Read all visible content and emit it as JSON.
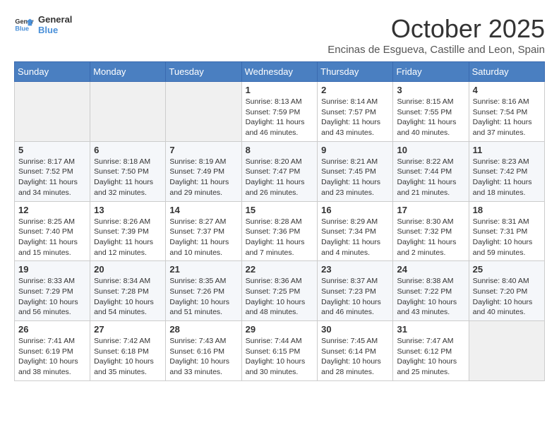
{
  "logo": {
    "general": "General",
    "blue": "Blue"
  },
  "header": {
    "month": "October 2025",
    "location": "Encinas de Esgueva, Castille and Leon, Spain"
  },
  "weekdays": [
    "Sunday",
    "Monday",
    "Tuesday",
    "Wednesday",
    "Thursday",
    "Friday",
    "Saturday"
  ],
  "weeks": [
    [
      {
        "day": "",
        "info": ""
      },
      {
        "day": "",
        "info": ""
      },
      {
        "day": "",
        "info": ""
      },
      {
        "day": "1",
        "info": "Sunrise: 8:13 AM\nSunset: 7:59 PM\nDaylight: 11 hours and 46 minutes."
      },
      {
        "day": "2",
        "info": "Sunrise: 8:14 AM\nSunset: 7:57 PM\nDaylight: 11 hours and 43 minutes."
      },
      {
        "day": "3",
        "info": "Sunrise: 8:15 AM\nSunset: 7:55 PM\nDaylight: 11 hours and 40 minutes."
      },
      {
        "day": "4",
        "info": "Sunrise: 8:16 AM\nSunset: 7:54 PM\nDaylight: 11 hours and 37 minutes."
      }
    ],
    [
      {
        "day": "5",
        "info": "Sunrise: 8:17 AM\nSunset: 7:52 PM\nDaylight: 11 hours and 34 minutes."
      },
      {
        "day": "6",
        "info": "Sunrise: 8:18 AM\nSunset: 7:50 PM\nDaylight: 11 hours and 32 minutes."
      },
      {
        "day": "7",
        "info": "Sunrise: 8:19 AM\nSunset: 7:49 PM\nDaylight: 11 hours and 29 minutes."
      },
      {
        "day": "8",
        "info": "Sunrise: 8:20 AM\nSunset: 7:47 PM\nDaylight: 11 hours and 26 minutes."
      },
      {
        "day": "9",
        "info": "Sunrise: 8:21 AM\nSunset: 7:45 PM\nDaylight: 11 hours and 23 minutes."
      },
      {
        "day": "10",
        "info": "Sunrise: 8:22 AM\nSunset: 7:44 PM\nDaylight: 11 hours and 21 minutes."
      },
      {
        "day": "11",
        "info": "Sunrise: 8:23 AM\nSunset: 7:42 PM\nDaylight: 11 hours and 18 minutes."
      }
    ],
    [
      {
        "day": "12",
        "info": "Sunrise: 8:25 AM\nSunset: 7:40 PM\nDaylight: 11 hours and 15 minutes."
      },
      {
        "day": "13",
        "info": "Sunrise: 8:26 AM\nSunset: 7:39 PM\nDaylight: 11 hours and 12 minutes."
      },
      {
        "day": "14",
        "info": "Sunrise: 8:27 AM\nSunset: 7:37 PM\nDaylight: 11 hours and 10 minutes."
      },
      {
        "day": "15",
        "info": "Sunrise: 8:28 AM\nSunset: 7:36 PM\nDaylight: 11 hours and 7 minutes."
      },
      {
        "day": "16",
        "info": "Sunrise: 8:29 AM\nSunset: 7:34 PM\nDaylight: 11 hours and 4 minutes."
      },
      {
        "day": "17",
        "info": "Sunrise: 8:30 AM\nSunset: 7:32 PM\nDaylight: 11 hours and 2 minutes."
      },
      {
        "day": "18",
        "info": "Sunrise: 8:31 AM\nSunset: 7:31 PM\nDaylight: 10 hours and 59 minutes."
      }
    ],
    [
      {
        "day": "19",
        "info": "Sunrise: 8:33 AM\nSunset: 7:29 PM\nDaylight: 10 hours and 56 minutes."
      },
      {
        "day": "20",
        "info": "Sunrise: 8:34 AM\nSunset: 7:28 PM\nDaylight: 10 hours and 54 minutes."
      },
      {
        "day": "21",
        "info": "Sunrise: 8:35 AM\nSunset: 7:26 PM\nDaylight: 10 hours and 51 minutes."
      },
      {
        "day": "22",
        "info": "Sunrise: 8:36 AM\nSunset: 7:25 PM\nDaylight: 10 hours and 48 minutes."
      },
      {
        "day": "23",
        "info": "Sunrise: 8:37 AM\nSunset: 7:23 PM\nDaylight: 10 hours and 46 minutes."
      },
      {
        "day": "24",
        "info": "Sunrise: 8:38 AM\nSunset: 7:22 PM\nDaylight: 10 hours and 43 minutes."
      },
      {
        "day": "25",
        "info": "Sunrise: 8:40 AM\nSunset: 7:20 PM\nDaylight: 10 hours and 40 minutes."
      }
    ],
    [
      {
        "day": "26",
        "info": "Sunrise: 7:41 AM\nSunset: 6:19 PM\nDaylight: 10 hours and 38 minutes."
      },
      {
        "day": "27",
        "info": "Sunrise: 7:42 AM\nSunset: 6:18 PM\nDaylight: 10 hours and 35 minutes."
      },
      {
        "day": "28",
        "info": "Sunrise: 7:43 AM\nSunset: 6:16 PM\nDaylight: 10 hours and 33 minutes."
      },
      {
        "day": "29",
        "info": "Sunrise: 7:44 AM\nSunset: 6:15 PM\nDaylight: 10 hours and 30 minutes."
      },
      {
        "day": "30",
        "info": "Sunrise: 7:45 AM\nSunset: 6:14 PM\nDaylight: 10 hours and 28 minutes."
      },
      {
        "day": "31",
        "info": "Sunrise: 7:47 AM\nSunset: 6:12 PM\nDaylight: 10 hours and 25 minutes."
      },
      {
        "day": "",
        "info": ""
      }
    ]
  ]
}
